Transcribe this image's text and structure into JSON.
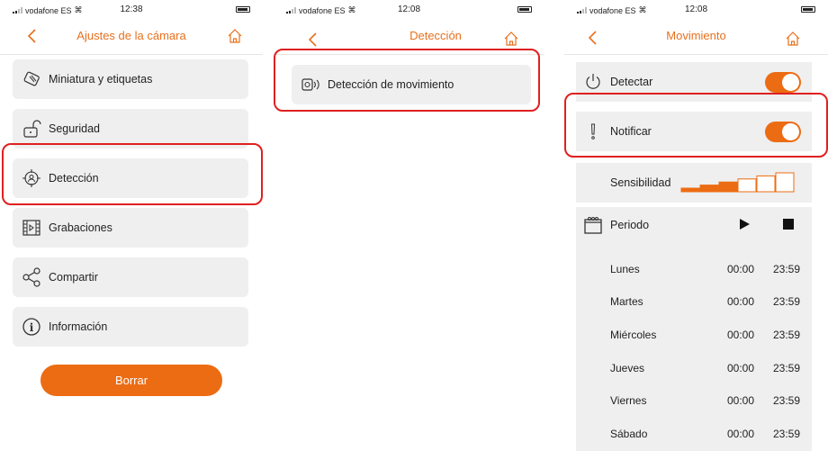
{
  "screens": [
    {
      "status": {
        "carrier": "vodafone ES",
        "time": "12:38"
      },
      "title": "Ajustes de la cámara",
      "menu": [
        {
          "label": "Miniatura y etiquetas",
          "icon": "image-tag-icon"
        },
        {
          "label": "Seguridad",
          "icon": "padlock-icon"
        },
        {
          "label": "Detección",
          "icon": "target-person-icon"
        },
        {
          "label": "Grabaciones",
          "icon": "film-icon"
        },
        {
          "label": "Compartir",
          "icon": "share-icon"
        },
        {
          "label": "Información",
          "icon": "info-icon"
        }
      ],
      "delete_label": "Borrar"
    },
    {
      "status": {
        "carrier": "vodafone ES",
        "time": "12:08"
      },
      "title": "Detección",
      "menu": [
        {
          "label": "Detección de movimiento",
          "icon": "motion-sensor-icon"
        }
      ]
    },
    {
      "status": {
        "carrier": "vodafone ES",
        "time": "12:08"
      },
      "title": "Movimiento",
      "detect_label": "Detectar",
      "detect_on": true,
      "notify_label": "Notificar",
      "notify_on": true,
      "sensitivity_label": "Sensibilidad",
      "sensitivity_level": 3,
      "sensitivity_max": 6,
      "period_label": "Periodo",
      "schedule": [
        {
          "day": "Lunes",
          "start": "00:00",
          "end": "23:59"
        },
        {
          "day": "Martes",
          "start": "00:00",
          "end": "23:59"
        },
        {
          "day": "Miércoles",
          "start": "00:00",
          "end": "23:59"
        },
        {
          "day": "Jueves",
          "start": "00:00",
          "end": "23:59"
        },
        {
          "day": "Viernes",
          "start": "00:00",
          "end": "23:59"
        },
        {
          "day": "Sábado",
          "start": "00:00",
          "end": "23:59"
        }
      ]
    }
  ],
  "colors": {
    "accent": "#ec6c13",
    "highlight": "#e02020",
    "row_bg": "#efefef"
  }
}
